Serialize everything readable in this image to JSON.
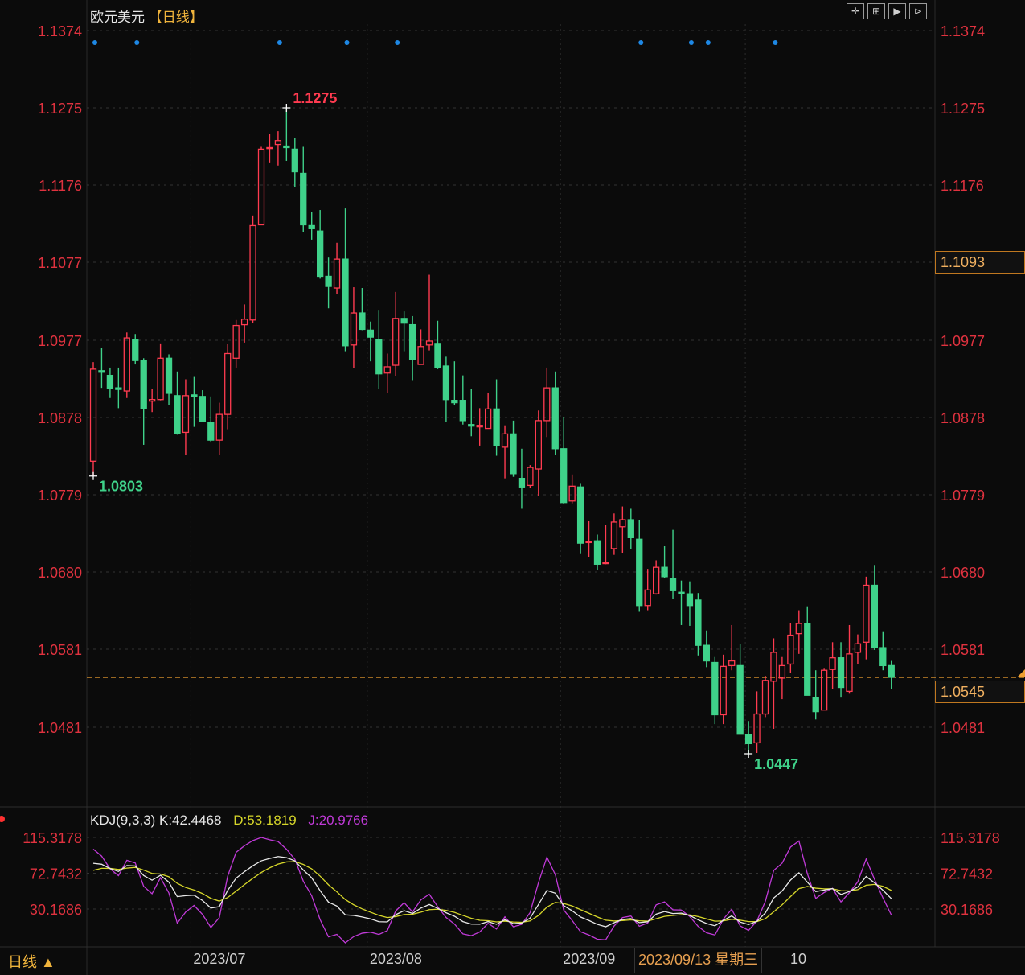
{
  "header": {
    "symbol": "欧元美元",
    "period": "【日线】",
    "tools": [
      "crosshair-tool",
      "zoom-fit-tool",
      "play-tool",
      "step-forward-tool"
    ],
    "tool_glyphs": [
      "✛",
      "⊞",
      "▶",
      "⊳"
    ]
  },
  "footer": {
    "period_button": "日线 ▲",
    "crosshair_date": "2023/09/13 星期三",
    "trailing_label": "10"
  },
  "price_boxes": {
    "crosshair_price": "1.1093",
    "last_price": "1.0545"
  },
  "colors": {
    "up": "#ff3b50",
    "down": "#3fd28a",
    "axis": "#e0323f",
    "k": "#e8e8e8",
    "d": "#d6d62a",
    "j": "#c03ad8",
    "last": "#f0a030",
    "marker": "#1e88e5"
  },
  "kdj": {
    "label": "KDJ(9,3,3)",
    "k_label": "K:42.4468",
    "d_label": "D:53.1819",
    "j_label": "J:20.9766"
  },
  "chart_data": {
    "type": "candlestick",
    "title": "欧元美元 日线",
    "ylim": [
      1.038,
      1.1374
    ],
    "y_ticks": [
      "1.1374",
      "1.1275",
      "1.1176",
      "1.1077",
      "1.0977",
      "1.0878",
      "1.0779",
      "1.0680",
      "1.0581",
      "1.0481"
    ],
    "x_ticks": [
      "2023/07",
      "2023/08",
      "2023/09"
    ],
    "x_tick_index": [
      12,
      33,
      56
    ],
    "annotations": [
      {
        "text": "1.1275",
        "index": 23,
        "price": 1.1275,
        "kind": "high"
      },
      {
        "text": "1.0803",
        "index": 0,
        "price": 1.0803,
        "kind": "low"
      },
      {
        "text": "1.0447",
        "index": 78,
        "price": 1.0447,
        "kind": "low"
      }
    ],
    "event_marker_index": [
      0,
      5,
      22,
      30,
      36,
      65,
      71,
      73,
      81
    ],
    "last_price": 1.0545,
    "ohlc": [
      [
        1.0822,
        1.0949,
        1.0803,
        1.094
      ],
      [
        1.0938,
        1.0967,
        1.0916,
        1.0936
      ],
      [
        1.0932,
        1.0942,
        1.0903,
        1.0915
      ],
      [
        1.0916,
        1.0942,
        1.089,
        1.0914
      ],
      [
        1.0912,
        1.0987,
        1.0903,
        1.098
      ],
      [
        1.0978,
        1.0985,
        1.0946,
        1.0951
      ],
      [
        1.0951,
        1.0954,
        1.0843,
        1.089
      ],
      [
        1.0899,
        1.0915,
        1.0885,
        1.0901
      ],
      [
        1.0901,
        1.0973,
        1.09,
        1.0954
      ],
      [
        1.0954,
        1.0959,
        1.0894,
        1.0909
      ],
      [
        1.0906,
        1.0937,
        1.0856,
        1.0858
      ],
      [
        1.0859,
        1.0927,
        1.083,
        1.0906
      ],
      [
        1.0907,
        1.093,
        1.0866,
        1.0905
      ],
      [
        1.0905,
        1.0913,
        1.0872,
        1.0873
      ],
      [
        1.0872,
        1.0905,
        1.0846,
        1.0849
      ],
      [
        1.0849,
        1.0897,
        1.083,
        1.0882
      ],
      [
        1.0882,
        1.0972,
        1.0863,
        1.096
      ],
      [
        1.0954,
        1.1003,
        1.0942,
        1.0996
      ],
      [
        1.0997,
        1.1023,
        1.0974,
        1.1004
      ],
      [
        1.1003,
        1.1137,
        1.0999,
        1.1124
      ],
      [
        1.1125,
        1.1225,
        1.1125,
        1.1222
      ],
      [
        1.1223,
        1.1241,
        1.1204,
        1.1224
      ],
      [
        1.1228,
        1.1245,
        1.1201,
        1.1233
      ],
      [
        1.1226,
        1.1275,
        1.1207,
        1.1224
      ],
      [
        1.1222,
        1.1236,
        1.1173,
        1.1193
      ],
      [
        1.1191,
        1.1225,
        1.1116,
        1.1125
      ],
      [
        1.1124,
        1.1142,
        1.1106,
        1.112
      ],
      [
        1.1117,
        1.1144,
        1.1056,
        1.1059
      ],
      [
        1.1059,
        1.1083,
        1.1018,
        1.1046
      ],
      [
        1.1044,
        1.1102,
        1.1036,
        1.1081
      ],
      [
        1.1081,
        1.1146,
        1.0963,
        1.097
      ],
      [
        1.0971,
        1.1045,
        1.0941,
        1.1012
      ],
      [
        1.1012,
        1.1044,
        1.099,
        1.0991
      ],
      [
        1.099,
        1.1001,
        1.095,
        1.0981
      ],
      [
        1.0978,
        1.1016,
        1.0915,
        1.0934
      ],
      [
        1.0935,
        1.096,
        1.0909,
        1.0943
      ],
      [
        1.0945,
        1.1039,
        1.0931,
        1.1005
      ],
      [
        1.1005,
        1.1014,
        1.0963,
        1.0999
      ],
      [
        1.0997,
        1.1008,
        1.0926,
        1.0952
      ],
      [
        1.0946,
        1.0991,
        1.0946,
        1.0969
      ],
      [
        1.0971,
        1.1061,
        1.0964,
        1.0976
      ],
      [
        1.0973,
        1.1002,
        1.094,
        1.0942
      ],
      [
        1.0944,
        1.0956,
        1.0872,
        1.0901
      ],
      [
        1.09,
        1.095,
        1.0894,
        1.0897
      ],
      [
        1.09,
        1.0932,
        1.0869,
        1.0874
      ],
      [
        1.0869,
        1.0915,
        1.0854,
        1.0867
      ],
      [
        1.0866,
        1.089,
        1.0842,
        1.0868
      ],
      [
        1.0864,
        1.091,
        1.0864,
        1.0889
      ],
      [
        1.0889,
        1.0927,
        1.0829,
        1.0842
      ],
      [
        1.084,
        1.0868,
        1.08,
        1.0857
      ],
      [
        1.0857,
        1.0874,
        1.0802,
        1.0806
      ],
      [
        1.08,
        1.0838,
        1.0761,
        1.0789
      ],
      [
        1.0791,
        1.0817,
        1.0788,
        1.0814
      ],
      [
        1.0812,
        1.0887,
        1.0778,
        1.0874
      ],
      [
        1.0874,
        1.0942,
        1.0853,
        1.0916
      ],
      [
        1.0916,
        1.0937,
        1.083,
        1.0838
      ],
      [
        1.0838,
        1.0879,
        1.0767,
        1.0769
      ],
      [
        1.0771,
        1.0805,
        1.0768,
        1.079
      ],
      [
        1.0789,
        1.0793,
        1.0703,
        1.0717
      ],
      [
        1.0718,
        1.0745,
        1.0699,
        1.0719
      ],
      [
        1.072,
        1.0728,
        1.0683,
        1.069
      ],
      [
        1.0691,
        1.074,
        1.069,
        1.0692
      ],
      [
        1.071,
        1.0755,
        1.0702,
        1.0744
      ],
      [
        1.0738,
        1.0764,
        1.0704,
        1.0747
      ],
      [
        1.0747,
        1.0761,
        1.0709,
        1.0724
      ],
      [
        1.0722,
        1.0747,
        1.0629,
        1.0637
      ],
      [
        1.0637,
        1.0684,
        1.0631,
        1.0657
      ],
      [
        1.0652,
        1.0695,
        1.0651,
        1.0686
      ],
      [
        1.0686,
        1.0713,
        1.0672,
        1.0674
      ],
      [
        1.0672,
        1.0734,
        1.0646,
        1.0656
      ],
      [
        1.0654,
        1.0669,
        1.0612,
        1.0652
      ],
      [
        1.0652,
        1.0668,
        1.0611,
        1.0637
      ],
      [
        1.0644,
        1.0653,
        1.0573,
        1.0586
      ],
      [
        1.0586,
        1.0605,
        1.0558,
        1.0566
      ],
      [
        1.0564,
        1.0571,
        1.0485,
        1.0497
      ],
      [
        1.0497,
        1.0574,
        1.0485,
        1.0559
      ],
      [
        1.056,
        1.0612,
        1.0554,
        1.0566
      ],
      [
        1.056,
        1.0588,
        1.0472,
        1.0472
      ],
      [
        1.0472,
        1.0489,
        1.0447,
        1.046
      ],
      [
        1.0461,
        1.0527,
        1.0448,
        1.0498
      ],
      [
        1.0498,
        1.0547,
        1.0494,
        1.0541
      ],
      [
        1.054,
        1.0595,
        1.0479,
        1.0577
      ],
      [
        1.0544,
        1.0571,
        1.0517,
        1.056
      ],
      [
        1.0562,
        1.0615,
        1.0551,
        1.0599
      ],
      [
        1.0601,
        1.0631,
        1.0575,
        1.0614
      ],
      [
        1.0614,
        1.0636,
        1.0522,
        1.0522
      ],
      [
        1.0519,
        1.0554,
        1.0491,
        1.0501
      ],
      [
        1.0503,
        1.0557,
        1.0503,
        1.0554
      ],
      [
        1.0555,
        1.059,
        1.053,
        1.057
      ],
      [
        1.057,
        1.059,
        1.0519,
        1.0532
      ],
      [
        1.0527,
        1.0612,
        1.0524,
        1.0575
      ],
      [
        1.0577,
        1.06,
        1.0562,
        1.0588
      ],
      [
        1.059,
        1.0674,
        1.0568,
        1.0663
      ],
      [
        1.0663,
        1.0689,
        1.058,
        1.0583
      ],
      [
        1.0583,
        1.0603,
        1.0554,
        1.056
      ],
      [
        1.056,
        1.0566,
        1.053,
        1.0545
      ]
    ],
    "kdj_axis": {
      "ticks": [
        "115.3178",
        "72.7432",
        "30.1686"
      ],
      "tick_values": [
        115.3178,
        72.7432,
        30.1686
      ]
    },
    "kdj_params": [
      9,
      3,
      3
    ]
  }
}
